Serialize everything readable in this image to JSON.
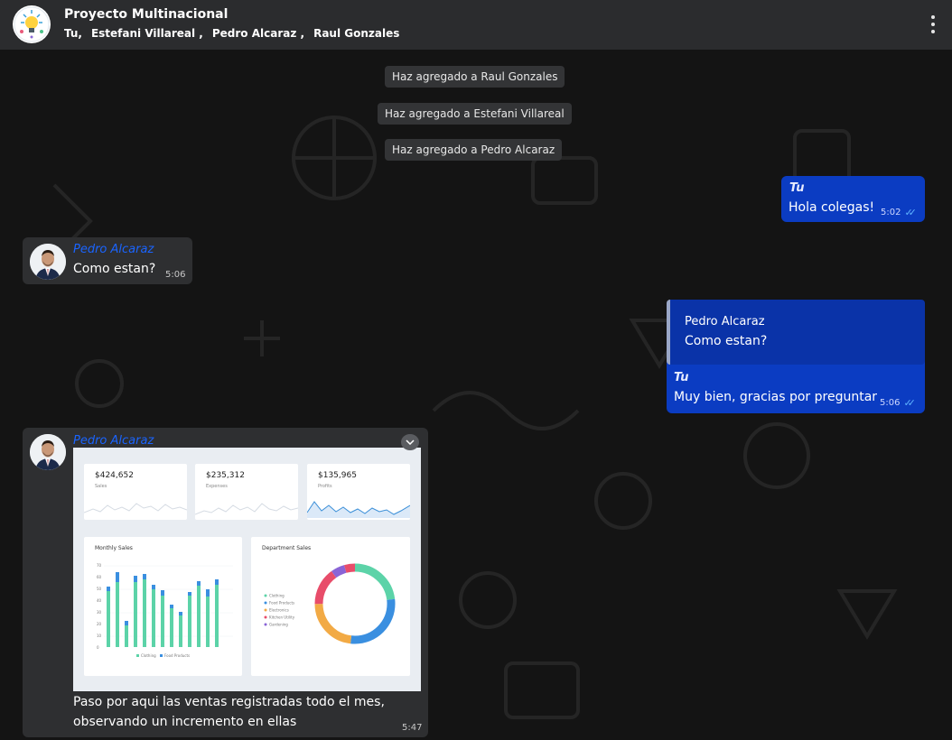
{
  "header": {
    "title": "Proyecto Multinacional",
    "members": [
      "Tu,",
      "Estefani Villareal ,",
      "Pedro Alcaraz ,",
      "Raul Gonzales"
    ],
    "menu_icon": "kebab-menu-icon",
    "avatar_icon": "lightbulb-icon"
  },
  "notices": [
    "Haz agregado a Raul Gonzales",
    "Haz agregado a Estefani Villareal",
    "Haz agregado a Pedro Alcaraz"
  ],
  "messages": {
    "m1": {
      "sender": "Tu",
      "text": "Hola colegas!",
      "time": "5:02"
    },
    "m2": {
      "sender": "Pedro Alcaraz",
      "text": "Como estan?",
      "time": "5:06"
    },
    "m3": {
      "quote_sender": "Pedro Alcaraz",
      "quote_text": "Como estan?",
      "sender": "Tu",
      "text": "Muy bien, gracias por preguntar",
      "time": "5:06"
    },
    "m4": {
      "sender": "Pedro Alcaraz",
      "text_line1": "Paso por aqui las ventas registradas todo el mes,",
      "text_line2": "observando un incremento en ellas",
      "time": "5:47"
    }
  },
  "dashboard": {
    "kpis": [
      {
        "value": "$424,652",
        "label": "Sales"
      },
      {
        "value": "$235,312",
        "label": "Expenses"
      },
      {
        "value": "$135,965",
        "label": "Profits"
      }
    ],
    "monthly_title": "Monthly Sales",
    "department_title": "Department Sales",
    "monthly_legend": [
      "Clothing",
      "Food Products"
    ],
    "department_legend": [
      "Clothing",
      "Food Products",
      "Electronics",
      "Kitchen Utility",
      "Gardening"
    ],
    "y_ticks": [
      "70",
      "60",
      "50",
      "40",
      "30",
      "20",
      "10",
      "0"
    ]
  },
  "colors": {
    "outgoing_bubble": "#0b3cc2",
    "incoming_bubble": "#2e2f31",
    "sender_name_incoming": "#1a64ff",
    "read_ticks": "#5fb3ff"
  }
}
